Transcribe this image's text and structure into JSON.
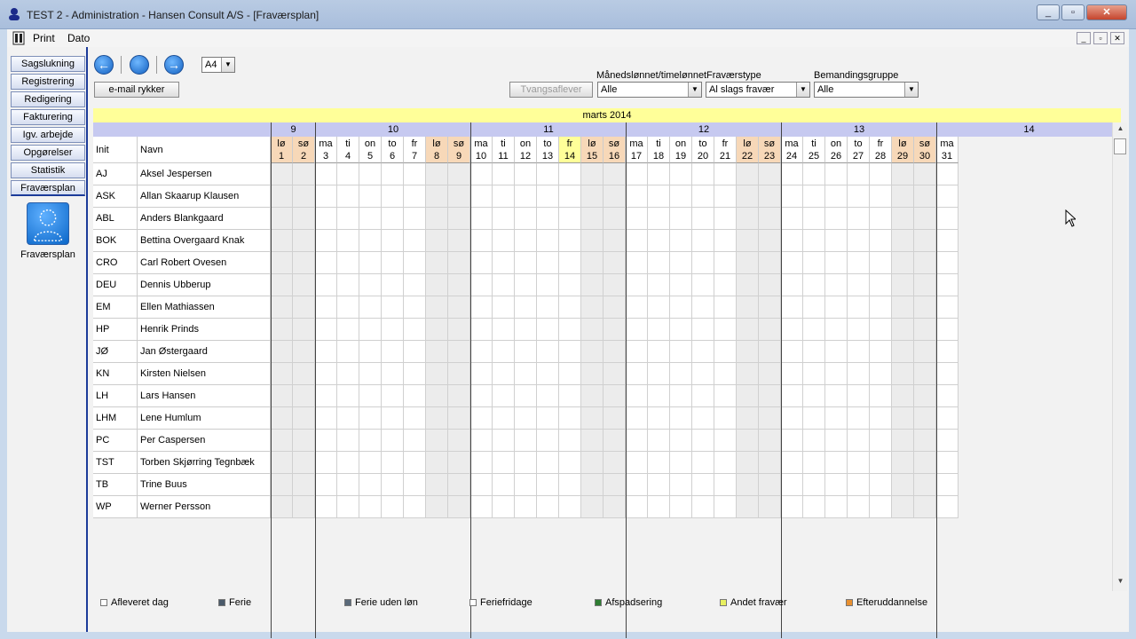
{
  "window": {
    "title": "TEST 2 - Administration - Hansen Consult A/S - [Fraværsplan]",
    "controls": {
      "minimize": "_",
      "restore": "▫",
      "close": "✕"
    }
  },
  "menu": {
    "print": "Print",
    "dato": "Dato"
  },
  "mdi_controls": {
    "minimize": "_",
    "restore": "▫",
    "close": "✕"
  },
  "nav": {
    "items": [
      "Sagslukning",
      "Registrering",
      "Redigering",
      "Fakturering",
      "Igv. arbejde",
      "Opgørelser",
      "Statistik",
      "Fraværsplan"
    ],
    "selected": "Fraværsplan",
    "module_label": "Fraværsplan"
  },
  "toolbar": {
    "back": "←",
    "home": "",
    "forward": "→",
    "paper_size": "A4",
    "email_button": "e-mail rykker",
    "forced_button": "Tvangsaflever"
  },
  "filters": {
    "salary_label": "Månedslønnet/timelønnet",
    "salary_value": "Alle",
    "absence_label": "Fraværstype",
    "absence_value": "Al slags fravær",
    "staffing_label": "Bemandingsgruppe",
    "staffing_value": "Alle"
  },
  "calendar": {
    "month": "marts 2014",
    "weeks": [
      "9",
      "10",
      "11",
      "12",
      "13",
      "14"
    ],
    "col_init": "Init",
    "col_navn": "Navn",
    "days": [
      {
        "d": "lø",
        "n": "1",
        "t": "we"
      },
      {
        "d": "sø",
        "n": "2",
        "t": "we"
      },
      {
        "d": "ma",
        "n": "3",
        "t": ""
      },
      {
        "d": "ti",
        "n": "4",
        "t": ""
      },
      {
        "d": "on",
        "n": "5",
        "t": ""
      },
      {
        "d": "to",
        "n": "6",
        "t": ""
      },
      {
        "d": "fr",
        "n": "7",
        "t": ""
      },
      {
        "d": "lø",
        "n": "8",
        "t": "we"
      },
      {
        "d": "sø",
        "n": "9",
        "t": "we"
      },
      {
        "d": "ma",
        "n": "10",
        "t": ""
      },
      {
        "d": "ti",
        "n": "11",
        "t": ""
      },
      {
        "d": "on",
        "n": "12",
        "t": ""
      },
      {
        "d": "to",
        "n": "13",
        "t": ""
      },
      {
        "d": "fr",
        "n": "14",
        "t": "hol"
      },
      {
        "d": "lø",
        "n": "15",
        "t": "we"
      },
      {
        "d": "sø",
        "n": "16",
        "t": "we"
      },
      {
        "d": "ma",
        "n": "17",
        "t": ""
      },
      {
        "d": "ti",
        "n": "18",
        "t": ""
      },
      {
        "d": "on",
        "n": "19",
        "t": ""
      },
      {
        "d": "to",
        "n": "20",
        "t": ""
      },
      {
        "d": "fr",
        "n": "21",
        "t": ""
      },
      {
        "d": "lø",
        "n": "22",
        "t": "we"
      },
      {
        "d": "sø",
        "n": "23",
        "t": "we"
      },
      {
        "d": "ma",
        "n": "24",
        "t": ""
      },
      {
        "d": "ti",
        "n": "25",
        "t": ""
      },
      {
        "d": "on",
        "n": "26",
        "t": ""
      },
      {
        "d": "to",
        "n": "27",
        "t": ""
      },
      {
        "d": "fr",
        "n": "28",
        "t": ""
      },
      {
        "d": "lø",
        "n": "29",
        "t": "we"
      },
      {
        "d": "sø",
        "n": "30",
        "t": "we"
      },
      {
        "d": "ma",
        "n": "31",
        "t": ""
      }
    ],
    "employees": [
      {
        "init": "AJ",
        "name": "Aksel Jespersen"
      },
      {
        "init": "ASK",
        "name": "Allan Skaarup Klausen"
      },
      {
        "init": "ABL",
        "name": "Anders Blankgaard"
      },
      {
        "init": "BOK",
        "name": "Bettina  Overgaard Knak"
      },
      {
        "init": "CRO",
        "name": "Carl Robert Ovesen"
      },
      {
        "init": "DEU",
        "name": "Dennis Ubberup"
      },
      {
        "init": "EM",
        "name": "Ellen Mathiassen"
      },
      {
        "init": "HP",
        "name": "Henrik Prinds"
      },
      {
        "init": "JØ",
        "name": "Jan Østergaard"
      },
      {
        "init": "KN",
        "name": "Kirsten Nielsen"
      },
      {
        "init": "LH",
        "name": "Lars Hansen"
      },
      {
        "init": "LHM",
        "name": "Lene Humlum"
      },
      {
        "init": "PC",
        "name": "Per Caspersen"
      },
      {
        "init": "TST",
        "name": "Torben Skjørring Tegnbæk"
      },
      {
        "init": "TB",
        "name": "Trine Buus"
      },
      {
        "init": "WP",
        "name": "Werner Persson"
      }
    ]
  },
  "legend": [
    {
      "label": "Afleveret dag",
      "color": "#ffffff"
    },
    {
      "label": "Ferie",
      "color": "#4a5a6a"
    },
    {
      "label": "Ferie uden løn",
      "color": "#5a6a7a"
    },
    {
      "label": "Feriefridage",
      "color": "#ffffff"
    },
    {
      "label": "Afspadsering",
      "color": "#2e7d32"
    },
    {
      "label": "Andet fravær",
      "color": "#e8f060"
    },
    {
      "label": "Efteruddannelse",
      "color": "#e89030"
    }
  ]
}
